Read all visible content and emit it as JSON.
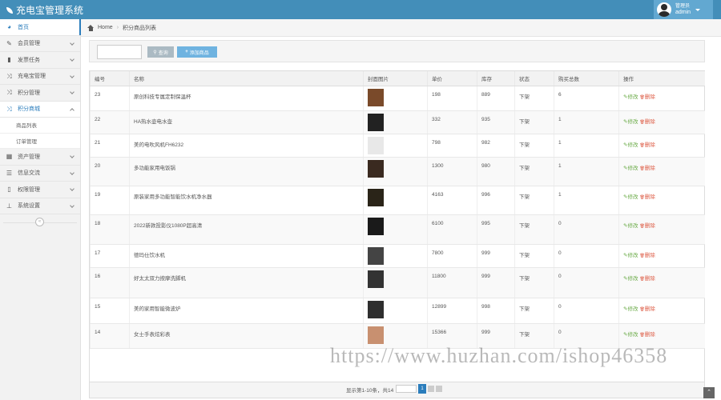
{
  "app": {
    "title": "充电宝管理系统"
  },
  "user": {
    "role": "管理员",
    "name": "admin"
  },
  "sidebar": {
    "items": [
      {
        "label": "首页",
        "icon": "dashboard-icon"
      },
      {
        "label": "会员管理",
        "icon": "edit-icon"
      },
      {
        "label": "发票任务",
        "icon": "book-icon"
      },
      {
        "label": "充电宝管理",
        "icon": "random-icon"
      },
      {
        "label": "积分管理",
        "icon": "random-icon"
      },
      {
        "label": "积分商城",
        "icon": "random-icon"
      }
    ],
    "subitems": [
      {
        "label": "商品列表"
      },
      {
        "label": "订单管理"
      }
    ],
    "items_after": [
      {
        "label": "资产管理",
        "icon": "calendar-icon"
      },
      {
        "label": "信息交流",
        "icon": "list-icon"
      },
      {
        "label": "权限管理",
        "icon": "file-icon"
      },
      {
        "label": "系统设置",
        "icon": "settings-icon"
      }
    ],
    "collapse_glyph": "«"
  },
  "breadcrumb": {
    "home": "Home",
    "separator": "›",
    "current": "积分商品列表"
  },
  "toolbar": {
    "search_placeholder": "",
    "search_label": "查询",
    "add_label": "添加商品",
    "search_icon": "search-icon",
    "add_icon": "plus-icon"
  },
  "table": {
    "headers": [
      "编号",
      "名称",
      "封面图片",
      "单价",
      "库存",
      "状态",
      "购买总数",
      "操作"
    ],
    "rows": [
      {
        "id": "23",
        "name": "原创科技专属定制保温杯",
        "price": "198",
        "stock": "889",
        "status": "下架",
        "sold": "6",
        "thumb": "#7a4a2a"
      },
      {
        "id": "22",
        "name": "HA热水壶电水壶",
        "price": "332",
        "stock": "935",
        "status": "下架",
        "sold": "1",
        "thumb": "#222222"
      },
      {
        "id": "21",
        "name": "美的电吹风机FH6232",
        "price": "798",
        "stock": "982",
        "status": "下架",
        "sold": "1",
        "thumb": "#e8e8e8"
      },
      {
        "id": "20",
        "name": "多功能家用电饭锅",
        "price": "1300",
        "stock": "980",
        "status": "下架",
        "sold": "1",
        "thumb": "#3a2a20"
      },
      {
        "id": "19",
        "name": "原装家用多功能智能饮水机净水器",
        "price": "4163",
        "stock": "996",
        "status": "下架",
        "sold": "1",
        "thumb": "#2a2418"
      },
      {
        "id": "18",
        "name": "2022新款投影仪1080P超高清",
        "price": "6100",
        "stock": "995",
        "status": "下架",
        "sold": "0",
        "thumb": "#1a1a1a"
      },
      {
        "id": "17",
        "name": "德玛仕饮水机",
        "price": "7800",
        "stock": "999",
        "status": "下架",
        "sold": "0",
        "thumb": "#444444"
      },
      {
        "id": "16",
        "name": "好太太双力按摩洗脚机",
        "price": "11800",
        "stock": "999",
        "status": "下架",
        "sold": "0",
        "thumb": "#333333"
      },
      {
        "id": "15",
        "name": "美的家用智能微波炉",
        "price": "12899",
        "stock": "998",
        "status": "下架",
        "sold": "0",
        "thumb": "#2e2e2e"
      },
      {
        "id": "14",
        "name": "女士手表炫彩表",
        "price": "15366",
        "stock": "999",
        "status": "下架",
        "sold": "0",
        "thumb": "#c89070"
      }
    ],
    "action_edit": "修改",
    "action_delete": "删除"
  },
  "pager": {
    "text": "显示第1-10条，共14",
    "current_page": "1"
  },
  "watermark": "https://www.huzhan.com/ishop46358",
  "scroll_top_glyph": "⌃"
}
